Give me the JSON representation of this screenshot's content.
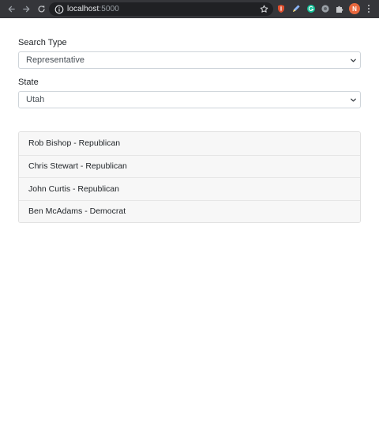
{
  "browser": {
    "url_host": "localhost",
    "url_port": ":5000",
    "profile_initial": "N"
  },
  "form": {
    "search_type": {
      "label": "Search Type",
      "selected": "Representative"
    },
    "state": {
      "label": "State",
      "selected": "Utah"
    }
  },
  "results": [
    {
      "text": "Rob Bishop - Republican"
    },
    {
      "text": "Chris Stewart - Republican"
    },
    {
      "text": "John Curtis - Republican"
    },
    {
      "text": "Ben McAdams - Democrat"
    }
  ],
  "icons": {
    "back": "arrow-left-icon",
    "forward": "arrow-right-icon",
    "reload": "reload-icon",
    "info": "info-icon",
    "bookmark": "star-icon",
    "extensions": "puzzle-icon",
    "menu": "kebab-menu-icon"
  },
  "colors": {
    "chrome_toolbar": "#35363a",
    "omnibox": "#202124",
    "avatar": "#e8683e",
    "list_bg": "#f7f7f7"
  }
}
